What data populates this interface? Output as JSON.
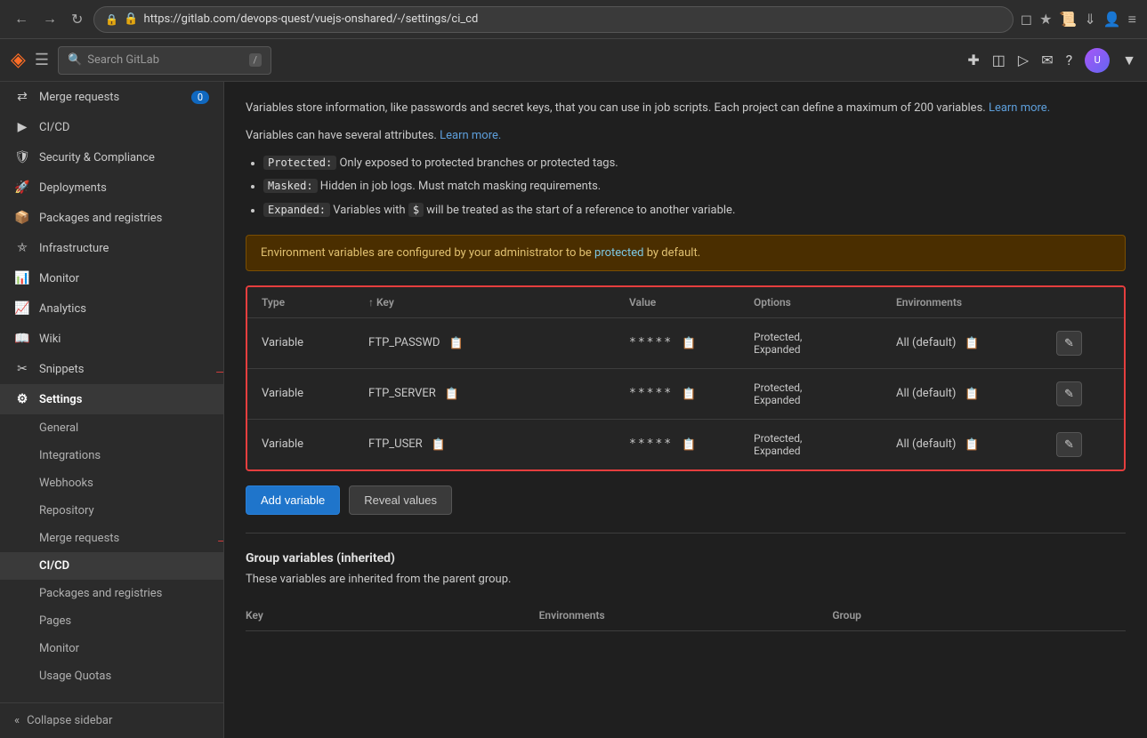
{
  "browser": {
    "url": "https://gitlab.com/devops-quest/vuejs-onshared/-/settings/ci_cd",
    "back_disabled": false,
    "forward_disabled": false
  },
  "gitlab_nav": {
    "search_placeholder": "Search GitLab",
    "slash_key": "/",
    "icons": [
      "plus",
      "windows",
      "merge",
      "chat",
      "help",
      "avatar"
    ]
  },
  "sidebar": {
    "items": [
      {
        "id": "merge-requests",
        "label": "Merge requests",
        "icon": "⚙",
        "badge": "0",
        "has_badge": true
      },
      {
        "id": "ci-cd",
        "label": "CI/CD",
        "icon": "▶"
      },
      {
        "id": "security",
        "label": "Security & Compliance",
        "icon": "🛡"
      },
      {
        "id": "deployments",
        "label": "Deployments",
        "icon": "🚀"
      },
      {
        "id": "packages",
        "label": "Packages and registries",
        "icon": "📦"
      },
      {
        "id": "infrastructure",
        "label": "Infrastructure",
        "icon": "🏗"
      },
      {
        "id": "monitor",
        "label": "Monitor",
        "icon": "📊"
      },
      {
        "id": "analytics",
        "label": "Analytics",
        "icon": "📈"
      },
      {
        "id": "wiki",
        "label": "Wiki",
        "icon": "📝"
      },
      {
        "id": "snippets",
        "label": "Snippets",
        "icon": "✂"
      },
      {
        "id": "settings",
        "label": "Settings",
        "icon": "⚙",
        "active": true
      }
    ],
    "sub_items": [
      {
        "id": "general",
        "label": "General"
      },
      {
        "id": "integrations",
        "label": "Integrations"
      },
      {
        "id": "webhooks",
        "label": "Webhooks"
      },
      {
        "id": "repository",
        "label": "Repository"
      },
      {
        "id": "merge-requests-sub",
        "label": "Merge requests"
      },
      {
        "id": "ci-cd-sub",
        "label": "CI/CD",
        "active": true
      },
      {
        "id": "packages-sub",
        "label": "Packages and registries"
      },
      {
        "id": "pages-sub",
        "label": "Pages"
      },
      {
        "id": "monitor-sub",
        "label": "Monitor"
      },
      {
        "id": "usage-quotas",
        "label": "Usage Quotas"
      }
    ],
    "collapse_label": "Collapse sidebar"
  },
  "content": {
    "info_text_1": "Variables store information, like passwords and secret keys, that you can use in job scripts. Each project can define a maximum of 200 variables.",
    "learn_more_1": "Learn more.",
    "info_text_2": "Variables can have several attributes.",
    "learn_more_2": "Learn more.",
    "bullets": [
      {
        "code": "Protected:",
        "text": " Only exposed to protected branches or protected tags."
      },
      {
        "code": "Masked:",
        "text": " Hidden in job logs. Must match masking requirements."
      },
      {
        "code": "Expanded:",
        "text": " Variables with ",
        "code2": "$",
        "text2": " will be treated as the start of a reference to another variable."
      }
    ],
    "warning_text": "Environment variables are configured by your administrator to be ",
    "warning_link": "protected",
    "warning_text2": " by default.",
    "table": {
      "headers": [
        "Type",
        "Key",
        "Value",
        "Options",
        "Environments"
      ],
      "rows": [
        {
          "type": "Variable",
          "key": "FTP_PASSWD",
          "value": "*****",
          "options": "Protected, Expanded",
          "environments": "All (default)"
        },
        {
          "type": "Variable",
          "key": "FTP_SERVER",
          "value": "*****",
          "options": "Protected, Expanded",
          "environments": "All (default)"
        },
        {
          "type": "Variable",
          "key": "FTP_USER",
          "value": "*****",
          "options": "Protected, Expanded",
          "environments": "All (default)"
        }
      ]
    },
    "add_variable_btn": "Add variable",
    "reveal_values_btn": "Reveal values",
    "divider": true,
    "group_section_title": "Group variables (inherited)",
    "group_section_desc": "These variables are inherited from the parent group.",
    "group_table_headers": [
      "Key",
      "Environments",
      "Group"
    ]
  }
}
